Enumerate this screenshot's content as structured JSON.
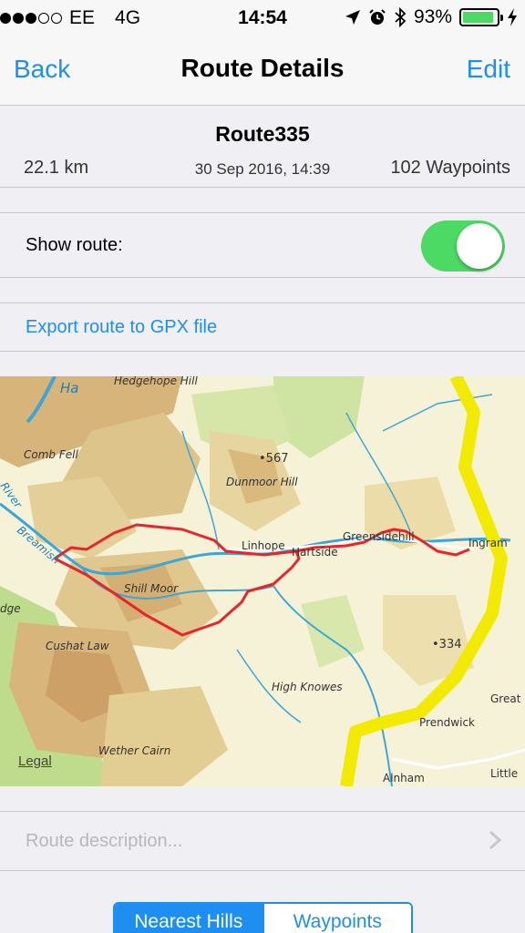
{
  "status_bar": {
    "carrier": "EE",
    "network": "4G",
    "time": "14:54",
    "battery": "93%",
    "battery_level": 0.93,
    "icons": [
      "signal-dots",
      "location-arrow-icon",
      "alarm-clock-icon",
      "bluetooth-icon",
      "battery-icon",
      "charging-bolt-icon"
    ]
  },
  "nav": {
    "back_label": "Back",
    "title": "Route Details",
    "edit_label": "Edit"
  },
  "route": {
    "name": "Route335",
    "distance": "22.1 km",
    "date": "30 Sep 2016, 14:39",
    "waypoints": "102 Waypoints"
  },
  "show_route": {
    "label": "Show route:",
    "on": true
  },
  "export": {
    "label": "Export route to GPX file"
  },
  "map": {
    "legal": "Legal",
    "labels": {
      "hedgehope": "Hedgehope Hill",
      "comb_fell": "Comb Fell",
      "spot_567": "•567",
      "dunmoor": "Dunmoor Hill",
      "breamish": "Breamish",
      "river": "River",
      "linhope": "Linhope",
      "hartside": "Hartside",
      "greensidehill": "Greensidehill",
      "ingram": "Ingram",
      "shill_moor": "Shill Moor",
      "edge": "dge",
      "cushat_law": "Cushat Law",
      "spot_334": "•334",
      "high_knowes": "High Knowes",
      "great": "Great",
      "prendwick": "Prendwick",
      "wether_cairn": "Wether Cairn",
      "alnham": "Alnham",
      "little": "Little",
      "ha": "Ha"
    },
    "colors": {
      "route": "#e8252b",
      "road": "#f2ea00",
      "water": "#3aa7d8",
      "hill_high": "#c8a165",
      "hill_mid": "#dcc78a",
      "woodland": "#b8d88a"
    }
  },
  "description": {
    "placeholder": "Route description..."
  },
  "segmented": {
    "nearest_hills": "Nearest Hills",
    "waypoints": "Waypoints"
  },
  "colors": {
    "accent": "#1f8ef1",
    "toggle_on": "#4cd964"
  }
}
